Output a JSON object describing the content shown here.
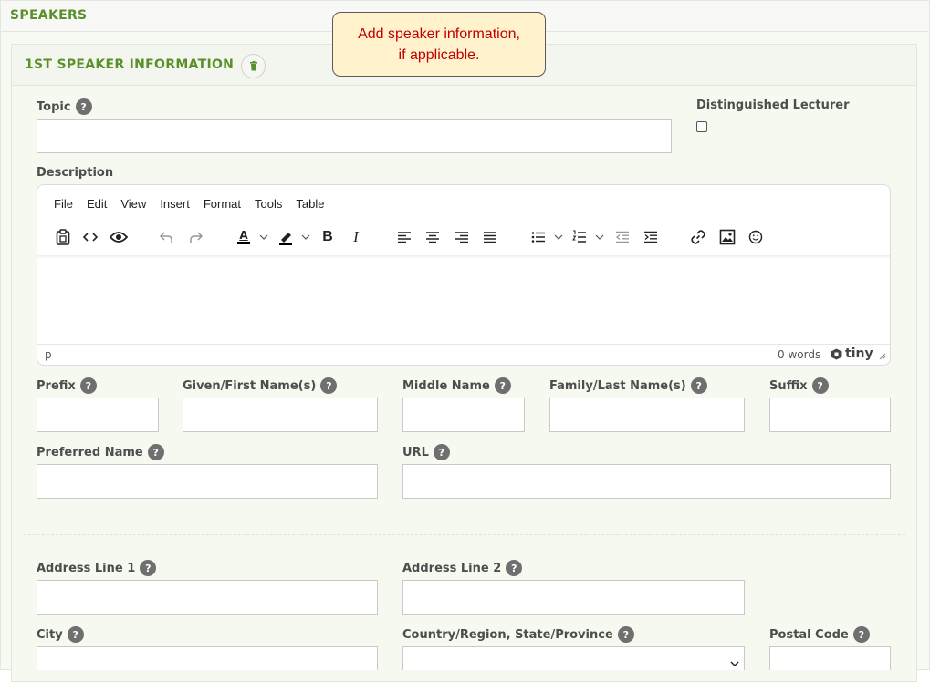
{
  "section": {
    "title": "SPEAKERS"
  },
  "callout": {
    "line1": "Add speaker information,",
    "line2": "if applicable."
  },
  "speaker_panel": {
    "title": "1ST SPEAKER INFORMATION"
  },
  "help_glyph": "?",
  "fields": {
    "topic": {
      "label": "Topic",
      "value": ""
    },
    "distinguished_lecturer": {
      "label": "Distinguished Lecturer",
      "checked": false
    },
    "description": {
      "label": "Description"
    },
    "prefix": {
      "label": "Prefix",
      "value": ""
    },
    "given_name": {
      "label": "Given/First Name(s)",
      "value": ""
    },
    "middle_name": {
      "label": "Middle Name",
      "value": ""
    },
    "family_name": {
      "label": "Family/Last Name(s)",
      "value": ""
    },
    "suffix": {
      "label": "Suffix",
      "value": ""
    },
    "preferred_name": {
      "label": "Preferred Name",
      "value": ""
    },
    "url": {
      "label": "URL",
      "value": ""
    },
    "address_line_1": {
      "label": "Address Line 1",
      "value": ""
    },
    "address_line_2": {
      "label": "Address Line 2",
      "value": ""
    },
    "city": {
      "label": "City",
      "value": ""
    },
    "country_region": {
      "label": "Country/Region, State/Province",
      "value": ""
    },
    "postal_code": {
      "label": "Postal Code",
      "value": ""
    }
  },
  "editor": {
    "menu": [
      "File",
      "Edit",
      "View",
      "Insert",
      "Format",
      "Tools",
      "Table"
    ],
    "toolbar_icons": [
      "paste-icon",
      "source-code-icon",
      "preview-eye-icon",
      "undo-icon",
      "redo-icon",
      "text-color-icon",
      "highlight-color-icon",
      "bold-icon",
      "italic-icon",
      "align-left-icon",
      "align-center-icon",
      "align-right-icon",
      "align-justify-icon",
      "bullet-list-icon",
      "numbered-list-icon",
      "outdent-icon",
      "indent-icon",
      "link-icon",
      "image-icon",
      "emoji-icon"
    ],
    "bold_glyph": "B",
    "italic_glyph": "I",
    "text_color_glyph": "A",
    "status_path": "p",
    "word_count": "0 words",
    "brand": "tiny"
  },
  "colors": {
    "accent_green": "#5b8f2c",
    "callout_text": "#c00000",
    "callout_bg": "#fff2cc",
    "help_badge": "#6f6f6f"
  }
}
